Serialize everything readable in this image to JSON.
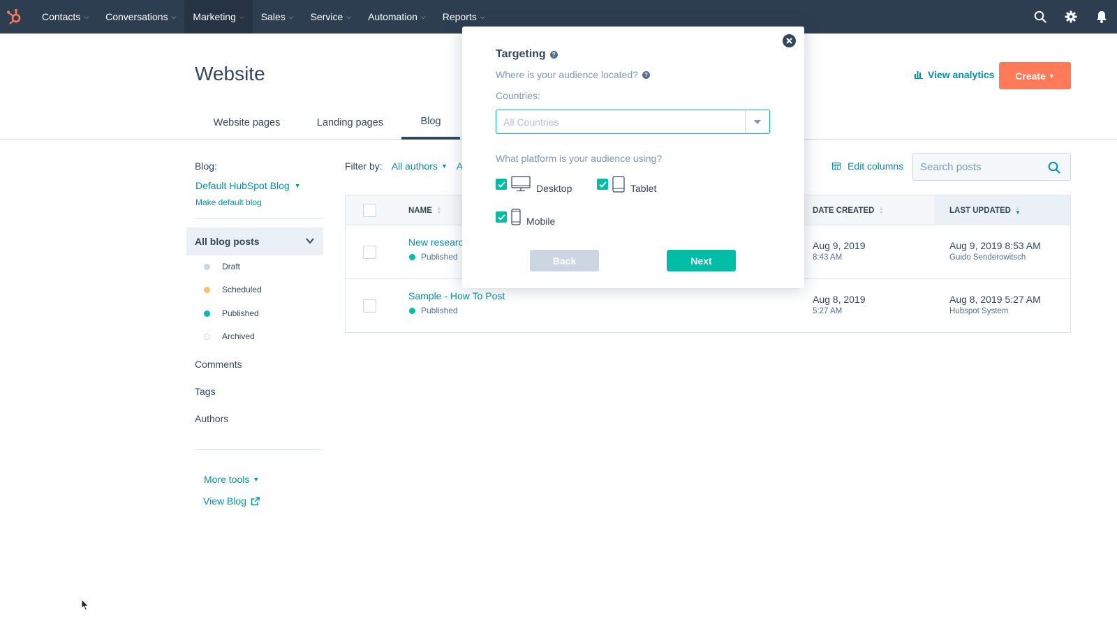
{
  "colors": {
    "nav_bg": "#2d3e50",
    "accent_orange": "#ff7a59",
    "link_teal": "#0091ae",
    "success_teal": "#00bda5",
    "text_dark": "#33475b"
  },
  "nav": {
    "items": [
      {
        "label": "Contacts"
      },
      {
        "label": "Conversations"
      },
      {
        "label": "Marketing",
        "active": true
      },
      {
        "label": "Sales"
      },
      {
        "label": "Service"
      },
      {
        "label": "Automation"
      },
      {
        "label": "Reports"
      }
    ],
    "right_icons": [
      "search-icon",
      "gear-icon",
      "bell-icon"
    ]
  },
  "header": {
    "title": "Website",
    "view_analytics": "View analytics",
    "create": "Create"
  },
  "tabs": [
    {
      "label": "Website pages"
    },
    {
      "label": "Landing pages"
    },
    {
      "label": "Blog",
      "active": true
    }
  ],
  "sidebar": {
    "blog_label": "Blog:",
    "blog_name": "Default HubSpot Blog",
    "make_default": "Make default blog",
    "all_posts": "All blog posts",
    "statuses": [
      {
        "label": "Draft",
        "color": "#cbd6e2"
      },
      {
        "label": "Scheduled",
        "color": "#f5c26b"
      },
      {
        "label": "Published",
        "color": "#00bda5"
      },
      {
        "label": "Archived",
        "color": "#ffffff"
      }
    ],
    "links": [
      "Comments",
      "Tags",
      "Authors"
    ],
    "more_tools": "More tools",
    "view_blog": "View Blog"
  },
  "toolbar": {
    "filter_by": "Filter by:",
    "all_authors": "All authors",
    "truncated_filter": "A",
    "edit_columns": "Edit columns",
    "search_placeholder": "Search posts"
  },
  "table": {
    "columns": {
      "name": "NAME",
      "date_created": "DATE CREATED",
      "last_updated": "LAST UPDATED"
    },
    "rows": [
      {
        "title": "New researc",
        "status": "Published",
        "created_date": "Aug 9, 2019",
        "created_time": "8:43 AM",
        "updated": "Aug 9, 2019 8:53 AM",
        "updated_by": "Guido Senderowitsch"
      },
      {
        "title": "Sample - How To Post",
        "status": "Published",
        "created_date": "Aug 8, 2019",
        "created_time": "5:27 AM",
        "updated": "Aug 8, 2019 5:27 AM",
        "updated_by": "Hubspot System"
      }
    ]
  },
  "modal": {
    "title": "Targeting",
    "question_location": "Where is your audience located?",
    "countries_label": "Countries:",
    "countries_placeholder": "All Countries",
    "question_platform": "What platform is your audience using?",
    "platforms": [
      {
        "label": "Desktop",
        "checked": true
      },
      {
        "label": "Tablet",
        "checked": true
      },
      {
        "label": "Mobile",
        "checked": true
      }
    ],
    "back": "Back",
    "next": "Next"
  }
}
